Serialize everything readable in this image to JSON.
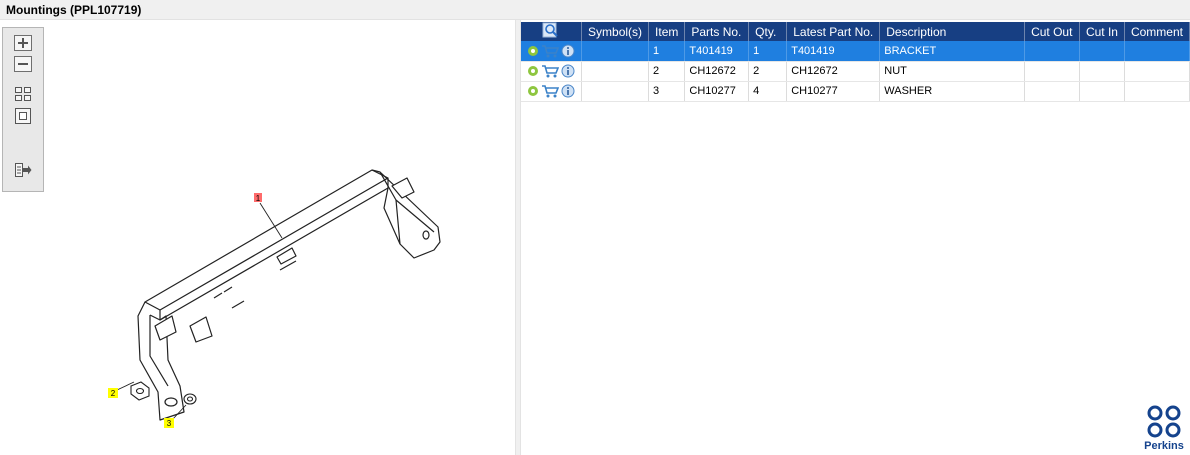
{
  "window": {
    "title": "Mountings (PPL107719)"
  },
  "toolbar": {
    "buttons": [
      {
        "icon": "zoom-in-icon"
      },
      {
        "icon": "zoom-out-icon"
      },
      {
        "icon": "fit-page-icon"
      },
      {
        "icon": "actual-size-icon"
      },
      {
        "icon": "export-icon"
      }
    ]
  },
  "drawing": {
    "callouts": [
      {
        "label": "1",
        "color": "#ff6b6b"
      },
      {
        "label": "2",
        "color": "#ffff00"
      },
      {
        "label": "3",
        "color": "#ffff00"
      }
    ]
  },
  "table": {
    "columns": [
      "Symbol(s)",
      "Item",
      "Parts No.",
      "Qty.",
      "Latest Part No.",
      "Description",
      "Cut Out",
      "Cut In",
      "Comment"
    ],
    "rows": [
      {
        "item": "1",
        "parts_no": "T401419",
        "qty": "1",
        "latest_part_no": "T401419",
        "description": "BRACKET",
        "cut_out": "",
        "cut_in": "",
        "comment": "",
        "selected": true
      },
      {
        "item": "2",
        "parts_no": "CH12672",
        "qty": "2",
        "latest_part_no": "CH12672",
        "description": "NUT",
        "cut_out": "",
        "cut_in": "",
        "comment": "",
        "selected": false
      },
      {
        "item": "3",
        "parts_no": "CH10277",
        "qty": "4",
        "latest_part_no": "CH10277",
        "description": "WASHER",
        "cut_out": "",
        "cut_in": "",
        "comment": "",
        "selected": false
      }
    ]
  },
  "colors": {
    "header": "#173f83",
    "selected_row": "#1f7fe0",
    "brand": "#15438d"
  },
  "logo": {
    "text": "Perkins"
  }
}
